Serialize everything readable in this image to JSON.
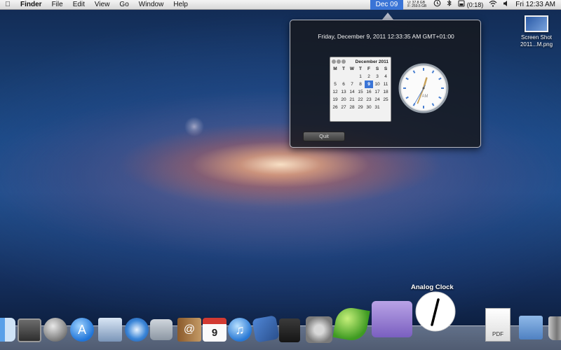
{
  "menubar": {
    "apple": "",
    "items": [
      "Finder",
      "File",
      "Edit",
      "View",
      "Go",
      "Window",
      "Help"
    ],
    "date_extra": "Dec 09",
    "stats_line1": "U: 37.8 GB",
    "stats_line2": "F: 259.5 GB",
    "battery": "(0:18)",
    "clock": "Fri 12:33 AM"
  },
  "popup": {
    "datetime": "Friday,    December 9, 2011 12:33:35 AM GMT+01:00",
    "quit_label": "Quit",
    "calendar": {
      "title": "December 2011",
      "dow": [
        "M",
        "T",
        "W",
        "T",
        "F",
        "S",
        "S"
      ],
      "weeks": [
        [
          "",
          "",
          "",
          "1",
          "2",
          "3",
          "4"
        ],
        [
          "5",
          "6",
          "7",
          "8",
          "9",
          "10",
          "11"
        ],
        [
          "12",
          "13",
          "14",
          "15",
          "16",
          "17",
          "18"
        ],
        [
          "19",
          "20",
          "21",
          "22",
          "23",
          "24",
          "25"
        ],
        [
          "26",
          "27",
          "28",
          "29",
          "30",
          "31",
          ""
        ]
      ],
      "today": "9"
    },
    "analog_clock": {
      "label": "AM",
      "hour": 12,
      "minute": 33,
      "second": 35
    }
  },
  "desktop": {
    "file_label_line1": "Screen Shot",
    "file_label_line2": "2011...M.png"
  },
  "dock": {
    "tooltip": "Analog Clock",
    "ical_date": "9",
    "pdf_label": "PDF",
    "items": [
      "finder-icon",
      "dashboard-icon",
      "launchpad-icon",
      "app-store-icon",
      "mail-icon",
      "safari-icon",
      "facetime-icon",
      "address-book-icon",
      "ical-icon",
      "itunes-icon",
      "xcode-icon",
      "preview-icon",
      "system-preferences-icon",
      "coda-leaf-icon",
      "transmit-truck-icon",
      "analog-clock-icon",
      "pdf-document-icon",
      "screenshots-folder-icon",
      "trash-icon"
    ]
  },
  "colors": {
    "menubar_highlight": "#3a74d6",
    "popup_background": "#16181e"
  }
}
